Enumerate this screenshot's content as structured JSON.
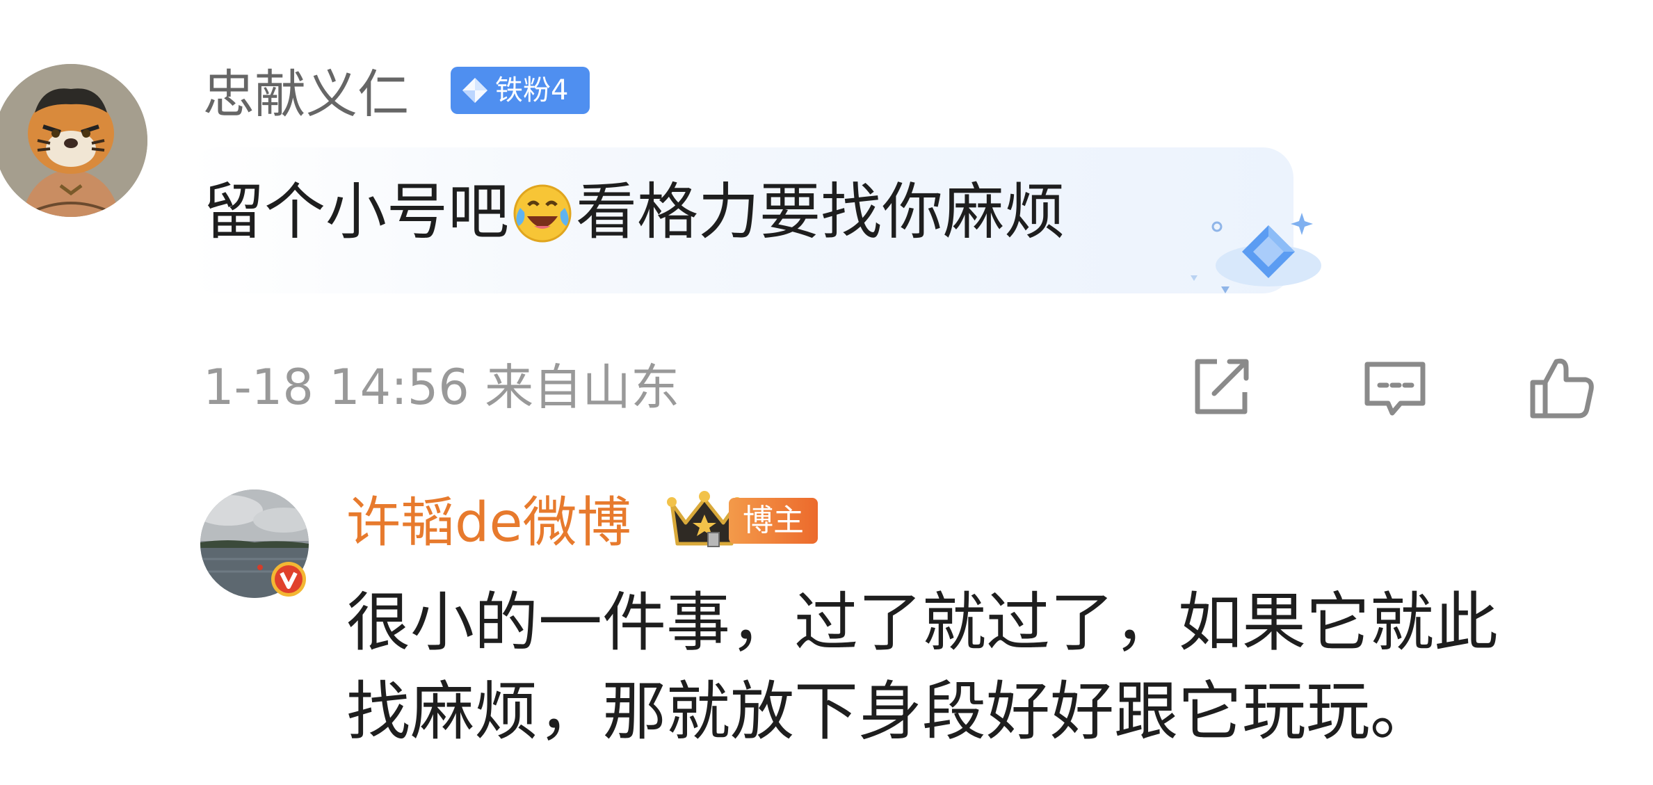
{
  "comment": {
    "username": "忠献义仁",
    "fan_badge": "铁粉4",
    "text_before_emoji": "留个小号吧",
    "emoji": "laugh-cry-emoji",
    "text_after_emoji": "看格力要找你麻烦",
    "meta": "1-18 14:56 来自山东",
    "actions": [
      "share-icon",
      "comment-icon",
      "like-icon"
    ]
  },
  "reply": {
    "username": "许韬de微博",
    "badge": "博主",
    "text_line1": "很小的一件事，过了就过了，如果它就此",
    "text_line2": "找麻烦，那就放下身段好好跟它玩玩。"
  },
  "colors": {
    "username_gray": "#666666",
    "meta_gray": "#999999",
    "fan_badge_blue": "#4f8ff0",
    "blogger_orange": "#e77a2d",
    "text": "#1e1e1e"
  }
}
